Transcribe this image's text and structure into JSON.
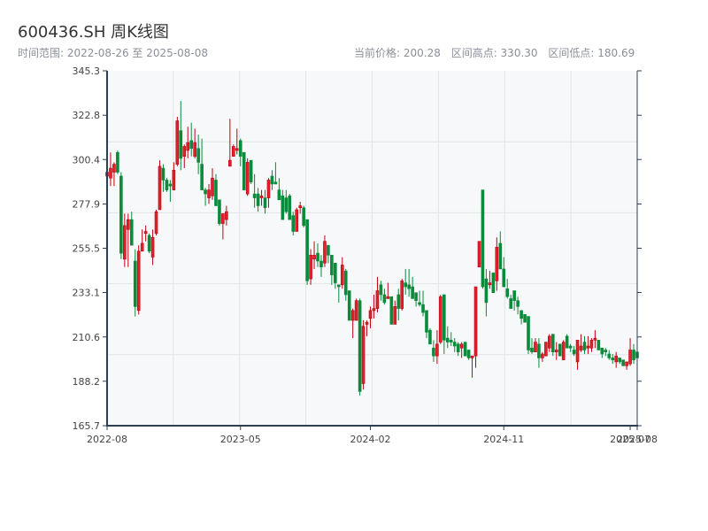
{
  "header": {
    "title": "600436.SH 周K线图",
    "range_label": "时间范围: 2022-08-26 至 2025-08-08",
    "current_price": "当前价格: 200.28",
    "range_high": "区间高点: 330.30",
    "range_low": "区间低点: 180.69"
  },
  "chart_data": {
    "type": "candlestick",
    "title": "600436.SH 周K线图",
    "ylim": [
      165.7,
      345.3
    ],
    "y_ticks": [
      "165.7",
      "188.2",
      "210.6",
      "233.1",
      "255.5",
      "277.9",
      "300.4",
      "322.8",
      "345.3"
    ],
    "x_ticks": [
      {
        "label": "2022-08",
        "index": 0
      },
      {
        "label": "2023-05",
        "index": 38
      },
      {
        "label": "2024-02",
        "index": 75
      },
      {
        "label": "2024-11",
        "index": 113
      },
      {
        "label": "2025-07",
        "index": 149
      },
      {
        "label": "2025-08",
        "index": 151
      }
    ],
    "grid": true,
    "colors": {
      "up": "#e0212b",
      "up_edge": "#c00010",
      "down": "#0a8a3a",
      "plot_bg": "#f6f8fa",
      "grid": "#e1e4e8",
      "axis": "#2c3e50"
    },
    "ohlc_fields": [
      "open",
      "close",
      "low",
      "high"
    ],
    "ohlc": [
      [
        292,
        294,
        291,
        295
      ],
      [
        291,
        296,
        287,
        304
      ],
      [
        294,
        298,
        287,
        299
      ],
      [
        304,
        294,
        293,
        305
      ],
      [
        292,
        253,
        250,
        294
      ],
      [
        250,
        267,
        246,
        273
      ],
      [
        265,
        270,
        246,
        273
      ],
      [
        270,
        257,
        257,
        274
      ],
      [
        249,
        226,
        221,
        255
      ],
      [
        224,
        254,
        222,
        257
      ],
      [
        254,
        258,
        254,
        265
      ],
      [
        263,
        264,
        259,
        267
      ],
      [
        262,
        254,
        253,
        263
      ],
      [
        251,
        261,
        247,
        265
      ],
      [
        263,
        274,
        262,
        275
      ],
      [
        275,
        297,
        275,
        300
      ],
      [
        296,
        290,
        284,
        298
      ],
      [
        290,
        285,
        284,
        291
      ],
      [
        288,
        287,
        279,
        290
      ],
      [
        285,
        295,
        285,
        299
      ],
      [
        298,
        320,
        297,
        322
      ],
      [
        315,
        301,
        295,
        330
      ],
      [
        302,
        307,
        296,
        308
      ],
      [
        305,
        309,
        301,
        317
      ],
      [
        310,
        306,
        302,
        319
      ],
      [
        302,
        309,
        301,
        316
      ],
      [
        306,
        299,
        293,
        313
      ],
      [
        298,
        285,
        285,
        311
      ],
      [
        285,
        283,
        277,
        286
      ],
      [
        281,
        285,
        278,
        288
      ],
      [
        282,
        291,
        280,
        296
      ],
      [
        290,
        277,
        277,
        293
      ],
      [
        280,
        268,
        267,
        280
      ],
      [
        268,
        273,
        260,
        273
      ],
      [
        270,
        274,
        267,
        277
      ],
      [
        297,
        300,
        297,
        321
      ],
      [
        302,
        307,
        302,
        308
      ],
      [
        305,
        306,
        303,
        316
      ],
      [
        310,
        302,
        297,
        311
      ],
      [
        304,
        285,
        285,
        304
      ],
      [
        283,
        299,
        282,
        301
      ],
      [
        300,
        289,
        288,
        300
      ],
      [
        283,
        281,
        276,
        293
      ],
      [
        283,
        277,
        274,
        286
      ],
      [
        281,
        282,
        277,
        285
      ],
      [
        281,
        276,
        273,
        285
      ],
      [
        281,
        290,
        276,
        291
      ],
      [
        292,
        288,
        285,
        295
      ],
      [
        289,
        288,
        288,
        299
      ],
      [
        285,
        280,
        280,
        291
      ],
      [
        282,
        270,
        270,
        285
      ],
      [
        281,
        274,
        273,
        285
      ],
      [
        282,
        270,
        270,
        283
      ],
      [
        272,
        264,
        262,
        274
      ],
      [
        264,
        275,
        264,
        276
      ],
      [
        276,
        277,
        273,
        279
      ],
      [
        276,
        267,
        266,
        277
      ],
      [
        270,
        239,
        237,
        270
      ],
      [
        240,
        252,
        237,
        255
      ],
      [
        250,
        252,
        245,
        259
      ],
      [
        253,
        249,
        246,
        258
      ],
      [
        249,
        246,
        241,
        252
      ],
      [
        248,
        259,
        246,
        262
      ],
      [
        257,
        252,
        248,
        257
      ],
      [
        252,
        242,
        237,
        252
      ],
      [
        248,
        238,
        235,
        248
      ],
      [
        237,
        236,
        228,
        237
      ],
      [
        237,
        247,
        235,
        251
      ],
      [
        244,
        232,
        229,
        245
      ],
      [
        234,
        219,
        219,
        234
      ],
      [
        219,
        224,
        210,
        225
      ],
      [
        219,
        229,
        219,
        230
      ],
      [
        229,
        183,
        181,
        230
      ],
      [
        187,
        216,
        184,
        219
      ],
      [
        217,
        218,
        211,
        219
      ],
      [
        220,
        224,
        215,
        226
      ],
      [
        224,
        225,
        220,
        232
      ],
      [
        225,
        234,
        223,
        241
      ],
      [
        237,
        232,
        229,
        239
      ],
      [
        232,
        228,
        227,
        235
      ],
      [
        230,
        231,
        230,
        238
      ],
      [
        231,
        217,
        217,
        231
      ],
      [
        217,
        226,
        217,
        229
      ],
      [
        232,
        225,
        219,
        235
      ],
      [
        225,
        239,
        224,
        240
      ],
      [
        238,
        236,
        232,
        245
      ],
      [
        237,
        235,
        231,
        245
      ],
      [
        236,
        230,
        230,
        241
      ],
      [
        233,
        229,
        226,
        233
      ],
      [
        228,
        227,
        226,
        234
      ],
      [
        227,
        223,
        221,
        234
      ],
      [
        224,
        213,
        210,
        224
      ],
      [
        214,
        207,
        207,
        215
      ],
      [
        205,
        201,
        198,
        209
      ],
      [
        201,
        207,
        197,
        214
      ],
      [
        208,
        231,
        207,
        232
      ],
      [
        232,
        209,
        202,
        232
      ],
      [
        210,
        208,
        205,
        216
      ],
      [
        209,
        208,
        206,
        213
      ],
      [
        208,
        206,
        203,
        210
      ],
      [
        207,
        203,
        201,
        208
      ],
      [
        205,
        207,
        200,
        208
      ],
      [
        208,
        201,
        201,
        208
      ],
      [
        204,
        200,
        199,
        204
      ],
      [
        200,
        201,
        190,
        201
      ],
      [
        201,
        236,
        195,
        236
      ],
      [
        246,
        259,
        246,
        259
      ],
      [
        285,
        236,
        235,
        285
      ],
      [
        240,
        228,
        221,
        245
      ],
      [
        237,
        238,
        235,
        244
      ],
      [
        243,
        233,
        233,
        243
      ],
      [
        239,
        256,
        234,
        261
      ],
      [
        258,
        245,
        245,
        264
      ],
      [
        245,
        236,
        236,
        251
      ],
      [
        235,
        231,
        230,
        240
      ],
      [
        230,
        225,
        225,
        232
      ],
      [
        234,
        229,
        224,
        234
      ],
      [
        229,
        226,
        222,
        231
      ],
      [
        224,
        220,
        217,
        224
      ],
      [
        222,
        218,
        218,
        222
      ],
      [
        221,
        204,
        202,
        221
      ],
      [
        205,
        203,
        202,
        210
      ],
      [
        203,
        208,
        203,
        210
      ],
      [
        207,
        200,
        195,
        210
      ],
      [
        200,
        202,
        198,
        203
      ],
      [
        201,
        208,
        201,
        208
      ],
      [
        205,
        211,
        203,
        212
      ],
      [
        212,
        203,
        201,
        212
      ],
      [
        203,
        204,
        199,
        208
      ],
      [
        207,
        201,
        201,
        207
      ],
      [
        199,
        208,
        199,
        209
      ],
      [
        211,
        205,
        205,
        212
      ],
      [
        206,
        205,
        203,
        207
      ],
      [
        204,
        202,
        201,
        206
      ],
      [
        198,
        209,
        194,
        209
      ],
      [
        204,
        206,
        203,
        212
      ],
      [
        208,
        204,
        202,
        211
      ],
      [
        205,
        206,
        202,
        211
      ],
      [
        205,
        209,
        203,
        210
      ],
      [
        209,
        210,
        205,
        214
      ],
      [
        209,
        204,
        204,
        209
      ],
      [
        205,
        202,
        200,
        205
      ],
      [
        204,
        203,
        201,
        205
      ],
      [
        202,
        200,
        199,
        204
      ],
      [
        200,
        199,
        197,
        202
      ],
      [
        198,
        201,
        195,
        203
      ],
      [
        200,
        198,
        197,
        200
      ],
      [
        199,
        196,
        196,
        199
      ],
      [
        196,
        198,
        194,
        198
      ],
      [
        197,
        204,
        196,
        210
      ],
      [
        204,
        199,
        197,
        207
      ],
      [
        203,
        200,
        198,
        204
      ]
    ]
  }
}
